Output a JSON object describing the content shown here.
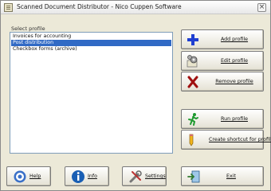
{
  "window": {
    "title": "Scanned Document Distributor - Nico Cuppen Software",
    "close_glyph": "×"
  },
  "profiles": {
    "label": "Select profile",
    "items": [
      "Invoices for accounting",
      "Post distribution",
      "Checkbox forms (archive)"
    ],
    "selected_index": 1
  },
  "side_buttons": {
    "add": {
      "label": "Add profile",
      "icon": "plus-icon"
    },
    "edit": {
      "label": "Edit profile",
      "icon": "edit-gear-icon"
    },
    "remove": {
      "label": "Remove profile",
      "icon": "x-icon"
    },
    "run": {
      "label": "Run profile",
      "icon": "running-man-icon"
    },
    "shortcut": {
      "label": "Create shortcut for profile",
      "icon": "pencil-icon"
    }
  },
  "bottom_buttons": {
    "help": {
      "label": "Help",
      "icon": "help-icon"
    },
    "info": {
      "label": "Info",
      "icon": "info-icon"
    },
    "settings": {
      "label": "Settings",
      "icon": "settings-icon"
    },
    "exit": {
      "label": "Exit",
      "icon": "exit-door-icon"
    }
  },
  "colors": {
    "selection": "#316ac5",
    "add_icon": "#1f3fd1",
    "remove_icon": "#a01010",
    "run_icon": "#1f9a2f",
    "info_icon": "#1a5fb4"
  }
}
